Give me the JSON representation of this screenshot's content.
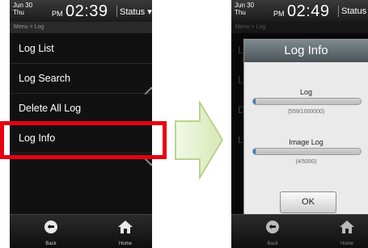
{
  "left_screen": {
    "status_bar": {
      "month_day": "Jun 30",
      "weekday": "Thu",
      "ampm": "PM",
      "time": "02:39",
      "status_label": "Status"
    },
    "breadcrumb": "Menu > Log",
    "menu_items": [
      "Log List",
      "Log Search",
      "Delete All Log",
      "Log Info"
    ],
    "highlighted_item": "Log Info",
    "bottom_nav": {
      "back_label": "Back",
      "home_label": "Home"
    }
  },
  "right_screen": {
    "status_bar": {
      "month_day": "Jun 30",
      "weekday": "Thu",
      "ampm": "PM",
      "time": "02:49",
      "status_label": "Status"
    },
    "breadcrumb": "Menu > Log",
    "dialog": {
      "title": "Log Info",
      "log": {
        "label": "Log",
        "count_text": "(559/1000000)",
        "fraction": 0.000559
      },
      "image_log": {
        "label": "Image Log",
        "count_text": "(4/5000)",
        "fraction": 0.0008
      },
      "ok_label": "OK"
    },
    "bottom_nav": {
      "back_label": "Back",
      "home_label": "Home"
    }
  },
  "colors": {
    "highlight": "#e60012",
    "arrow_fill": "#e3f0cc",
    "progress_fill": "#3a76c8"
  }
}
